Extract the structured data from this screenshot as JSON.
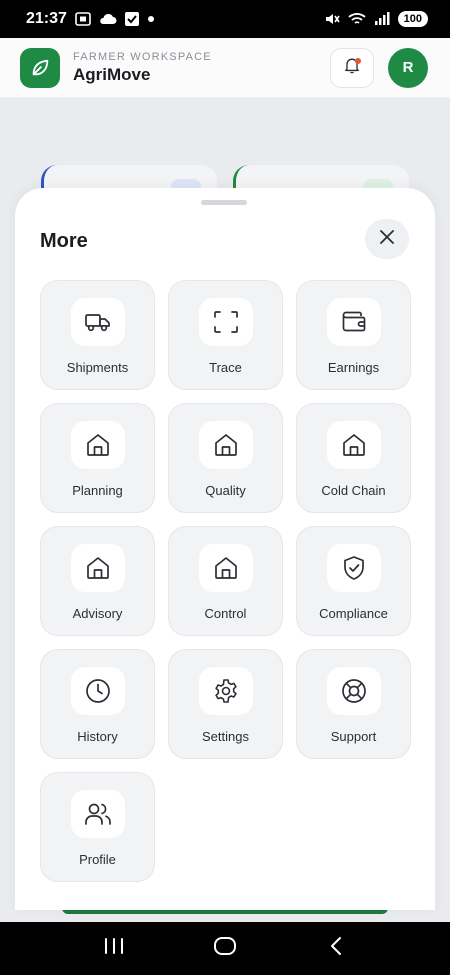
{
  "status_bar": {
    "time": "21:37",
    "battery": "100",
    "left_icons": [
      "screenshot-icon",
      "cloud-icon",
      "check-box-icon",
      "dot-icon"
    ],
    "right_icons": [
      "mute-icon",
      "wifi-icon",
      "signal-icon",
      "battery-icon"
    ]
  },
  "header": {
    "subtitle": "FARMER WORKSPACE",
    "title": "AgriMove",
    "avatar_initial": "R",
    "logo_icon": "leaf-icon",
    "bell_icon": "bell-icon",
    "accent_color": "#1e8a44",
    "notification_dot_color": "#e9553a"
  },
  "sheet": {
    "title": "More",
    "close_icon": "close-icon",
    "items": [
      {
        "label": "Shipments",
        "icon": "truck-icon"
      },
      {
        "label": "Trace",
        "icon": "scan-icon"
      },
      {
        "label": "Earnings",
        "icon": "wallet-icon"
      },
      {
        "label": "Planning",
        "icon": "home-icon"
      },
      {
        "label": "Quality",
        "icon": "home-icon"
      },
      {
        "label": "Cold Chain",
        "icon": "home-icon"
      },
      {
        "label": "Advisory",
        "icon": "home-icon"
      },
      {
        "label": "Control",
        "icon": "home-icon"
      },
      {
        "label": "Compliance",
        "icon": "shield-check-icon"
      },
      {
        "label": "History",
        "icon": "clock-icon"
      },
      {
        "label": "Settings",
        "icon": "gear-icon"
      },
      {
        "label": "Support",
        "icon": "lifebuoy-icon"
      },
      {
        "label": "Profile",
        "icon": "users-icon"
      }
    ]
  },
  "nav_bar": {
    "buttons": [
      "recent-apps-icon",
      "home-button-icon",
      "back-icon"
    ]
  }
}
